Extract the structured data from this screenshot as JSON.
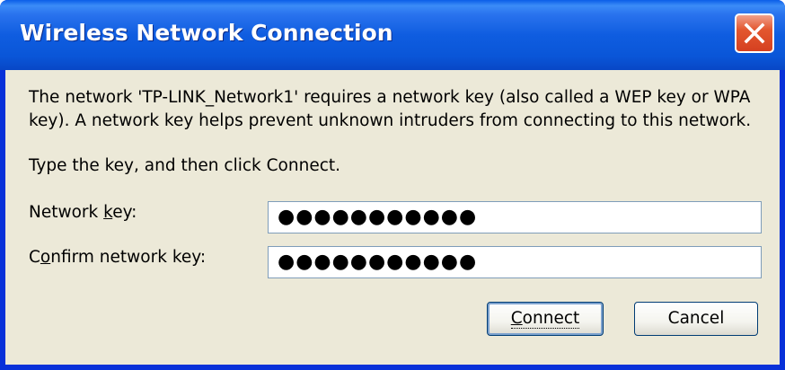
{
  "window": {
    "title": "Wireless Network Connection",
    "close_icon": "close-icon",
    "accent_color": "#0a56d8",
    "close_color": "#e3572f"
  },
  "content": {
    "message": "The network 'TP-LINK_Network1' requires a network key (also called a WEP key or WPA key). A network key helps prevent unknown intruders from connecting to this network.",
    "instruction": "Type the key, and then click Connect."
  },
  "fields": {
    "network_key": {
      "label_pre": "Network ",
      "label_accel": "k",
      "label_post": "ey:",
      "value": "●●●●●●●●●●●"
    },
    "confirm_key": {
      "label_pre": "C",
      "label_accel": "o",
      "label_post": "nfirm network key:",
      "value": "●●●●●●●●●●●"
    }
  },
  "buttons": {
    "connect_accel": "C",
    "connect_rest": "onnect",
    "cancel": "Cancel"
  }
}
